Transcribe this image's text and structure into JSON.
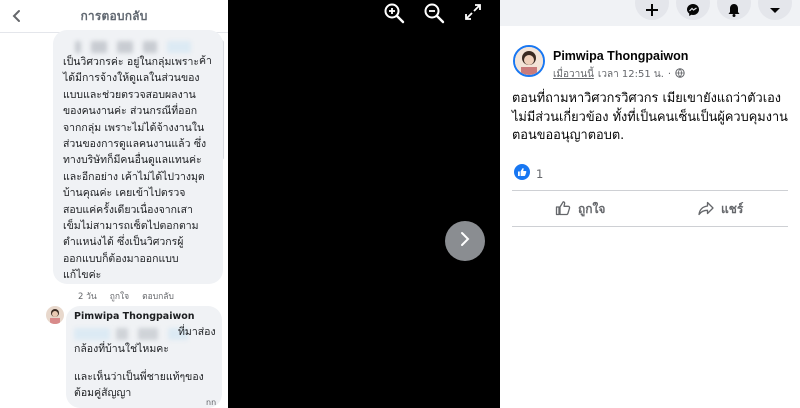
{
  "comments_panel": {
    "title": "การตอบกลับ",
    "first_comment": {
      "text": "เป็นวิศวกรค่ะ อยู่ในกลุ่มเพราะ\nได้มีการจ้างให้ดูแลในส่วนของ\nแบบและช่วยตรวจสอบผลงาน\nของคนงานค่ะ ส่วนกรณีที่ออก\nจากกลุ่ม เพราะไม่ได้จ้างงานใน\nส่วนของการดูแลคนงานแล้ว ซึ่ง\nทางบริษัทก็มีคนอื่นดูแลแทนค่ะ\nและอีกอย่าง เค้าไม่ได้ไปวางมุต\nบ้านคุณค่ะ เคยเข้าไปตรวจ\nสอบแค่ครั้งเดียวเนื่องจากเสา\nเข็มไม่สามารถเซ็ตไปตอกตาม\nตำแหน่งได้ ซึ่งเป็นวิศวกรผู้\nออกแบบก็ต้องมาออกแบบ\nแก้ไขค่ะ",
      "tail": "ค้า",
      "time": "2 วัน",
      "like_label": "ถูกใจ",
      "reply_label": "ตอบกลับ"
    },
    "second_comment": {
      "author": "Pimwipa Thongpaiwon",
      "tail": "ที่มาส่อง",
      "line1": "กล้องที่บ้านใช่ไหมคะ",
      "line2": "และเห็นว่าเป็นพี่ชายแท้ๆของ",
      "line3": "ต้อมคู่สัญญา"
    },
    "corner_text": "nn"
  },
  "viewer": {
    "icons": [
      "zoom-in-icon",
      "zoom-out-icon",
      "fullscreen-icon",
      "next-arrow-icon"
    ]
  },
  "post": {
    "author": "Pimwipa Thongpaiwon",
    "time_link": "เมื่อวานนี้",
    "time_rest": "เวลา 12:51 น.",
    "separator": "·",
    "body": "ตอนที่ถามหาวิศวกรวิศวกร เมียเขายังแถว่าตัวเองไม่มีส่วนเกี่ยวข้อง ทั้งที่เป็นคนเซ็นเป็นผู้ควบคุมงานตอนขออนุญาตอบต.",
    "reaction_count": "1",
    "like_label": "ถูกใจ",
    "share_label": "แชร์"
  },
  "colors": {
    "brand_blue": "#1877f2",
    "bubble_bg": "#f0f2f5",
    "secondary_text": "#65676b"
  }
}
